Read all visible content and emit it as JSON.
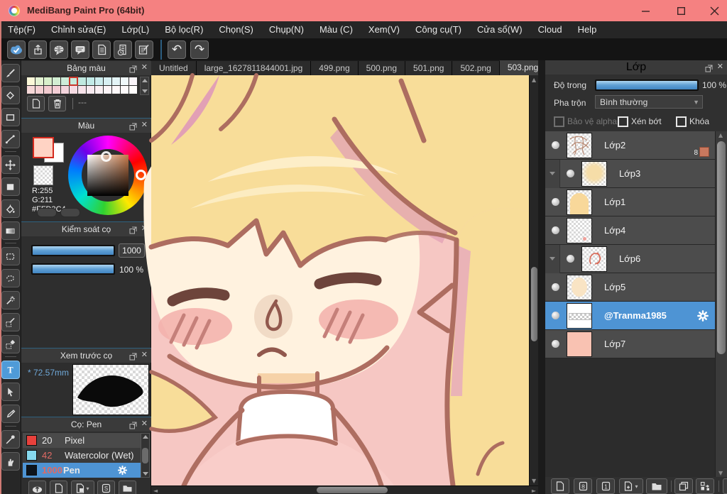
{
  "window": {
    "title": "MediBang Paint Pro (64bit)"
  },
  "menu": {
    "items": [
      "Tệp(F)",
      "Chỉnh sửa(E)",
      "Lớp(L)",
      "Bộ lọc(R)",
      "Chọn(S)",
      "Chụp(N)",
      "Màu (C)",
      "Xem(V)",
      "Công cụ(T)",
      "Cửa sổ(W)",
      "Cloud",
      "Help"
    ]
  },
  "tabs": {
    "items": [
      "Untitled",
      "large_1627811844001.jpg",
      "499.png",
      "500.png",
      "501.png",
      "502.png",
      "503.png"
    ],
    "active": "503.png"
  },
  "palette": {
    "title": "Bảng màu",
    "empty_value": "---",
    "row1": [
      "#fbf8d8",
      "#e3f2d2",
      "#d8efcb",
      "#d2eed3",
      "#cdecd9",
      "#c8ebdd",
      "#c0e9e0",
      "#c2eae7",
      "#cdedee",
      "#d8f0f3",
      "#e4f4f7",
      "#f0f9fb",
      "#faf5fa"
    ],
    "row2": [
      "#f6d8d8",
      "#f4d0d3",
      "#f2cbd0",
      "#f3ced5",
      "#f4d5dd",
      "#f6dce4",
      "#f8e3ea",
      "#f9eaf0",
      "#fbf0f4",
      "#fcf4f7",
      "#fdf7f9",
      "#fefafb",
      "#fffdfd"
    ]
  },
  "color_panel": {
    "title": "Màu",
    "r": "R:255",
    "g": "G:211",
    "hex": "#FFD3C4",
    "foreground": "#ffd3c4"
  },
  "brush_control": {
    "title": "Kiểm soát cọ",
    "size": "1000",
    "opacity": "100 %"
  },
  "brush_preview": {
    "title": "Xem trước cọ",
    "size_label": "* 72.57mm"
  },
  "brushes": {
    "title": "Cọ: Pen",
    "items": [
      {
        "size": "20",
        "name": "Pixel",
        "chip": "#e8413c"
      },
      {
        "size": "42",
        "name": "Watercolor (Wet)",
        "chip": "#86d9ee"
      },
      {
        "size": "1000",
        "name": "Pen",
        "chip": "#0d141c"
      }
    ]
  },
  "layers": {
    "title": "Lớp",
    "opacity_label": "Độ trong",
    "opacity_value": "100 %",
    "blend_label": "Pha trộn",
    "blend_value": "Bình thường",
    "cb_alpha": "Bảo vệ alpha",
    "cb_clip": "Xén bớt",
    "cb_lock": "Khóa",
    "badge8": "8",
    "rows": [
      {
        "name": "Lớp2"
      },
      {
        "name": "Lớp3"
      },
      {
        "name": "Lớp1"
      },
      {
        "name": "Lớp4"
      },
      {
        "name": "Lớp6"
      },
      {
        "name": "Lớp5"
      },
      {
        "name": "@Tranma1985"
      },
      {
        "name": "Lớp7"
      }
    ]
  },
  "colors": {
    "titlebar": "#f58181",
    "accent_blue": "#4e94d4",
    "selection_red": "#c9372c"
  }
}
